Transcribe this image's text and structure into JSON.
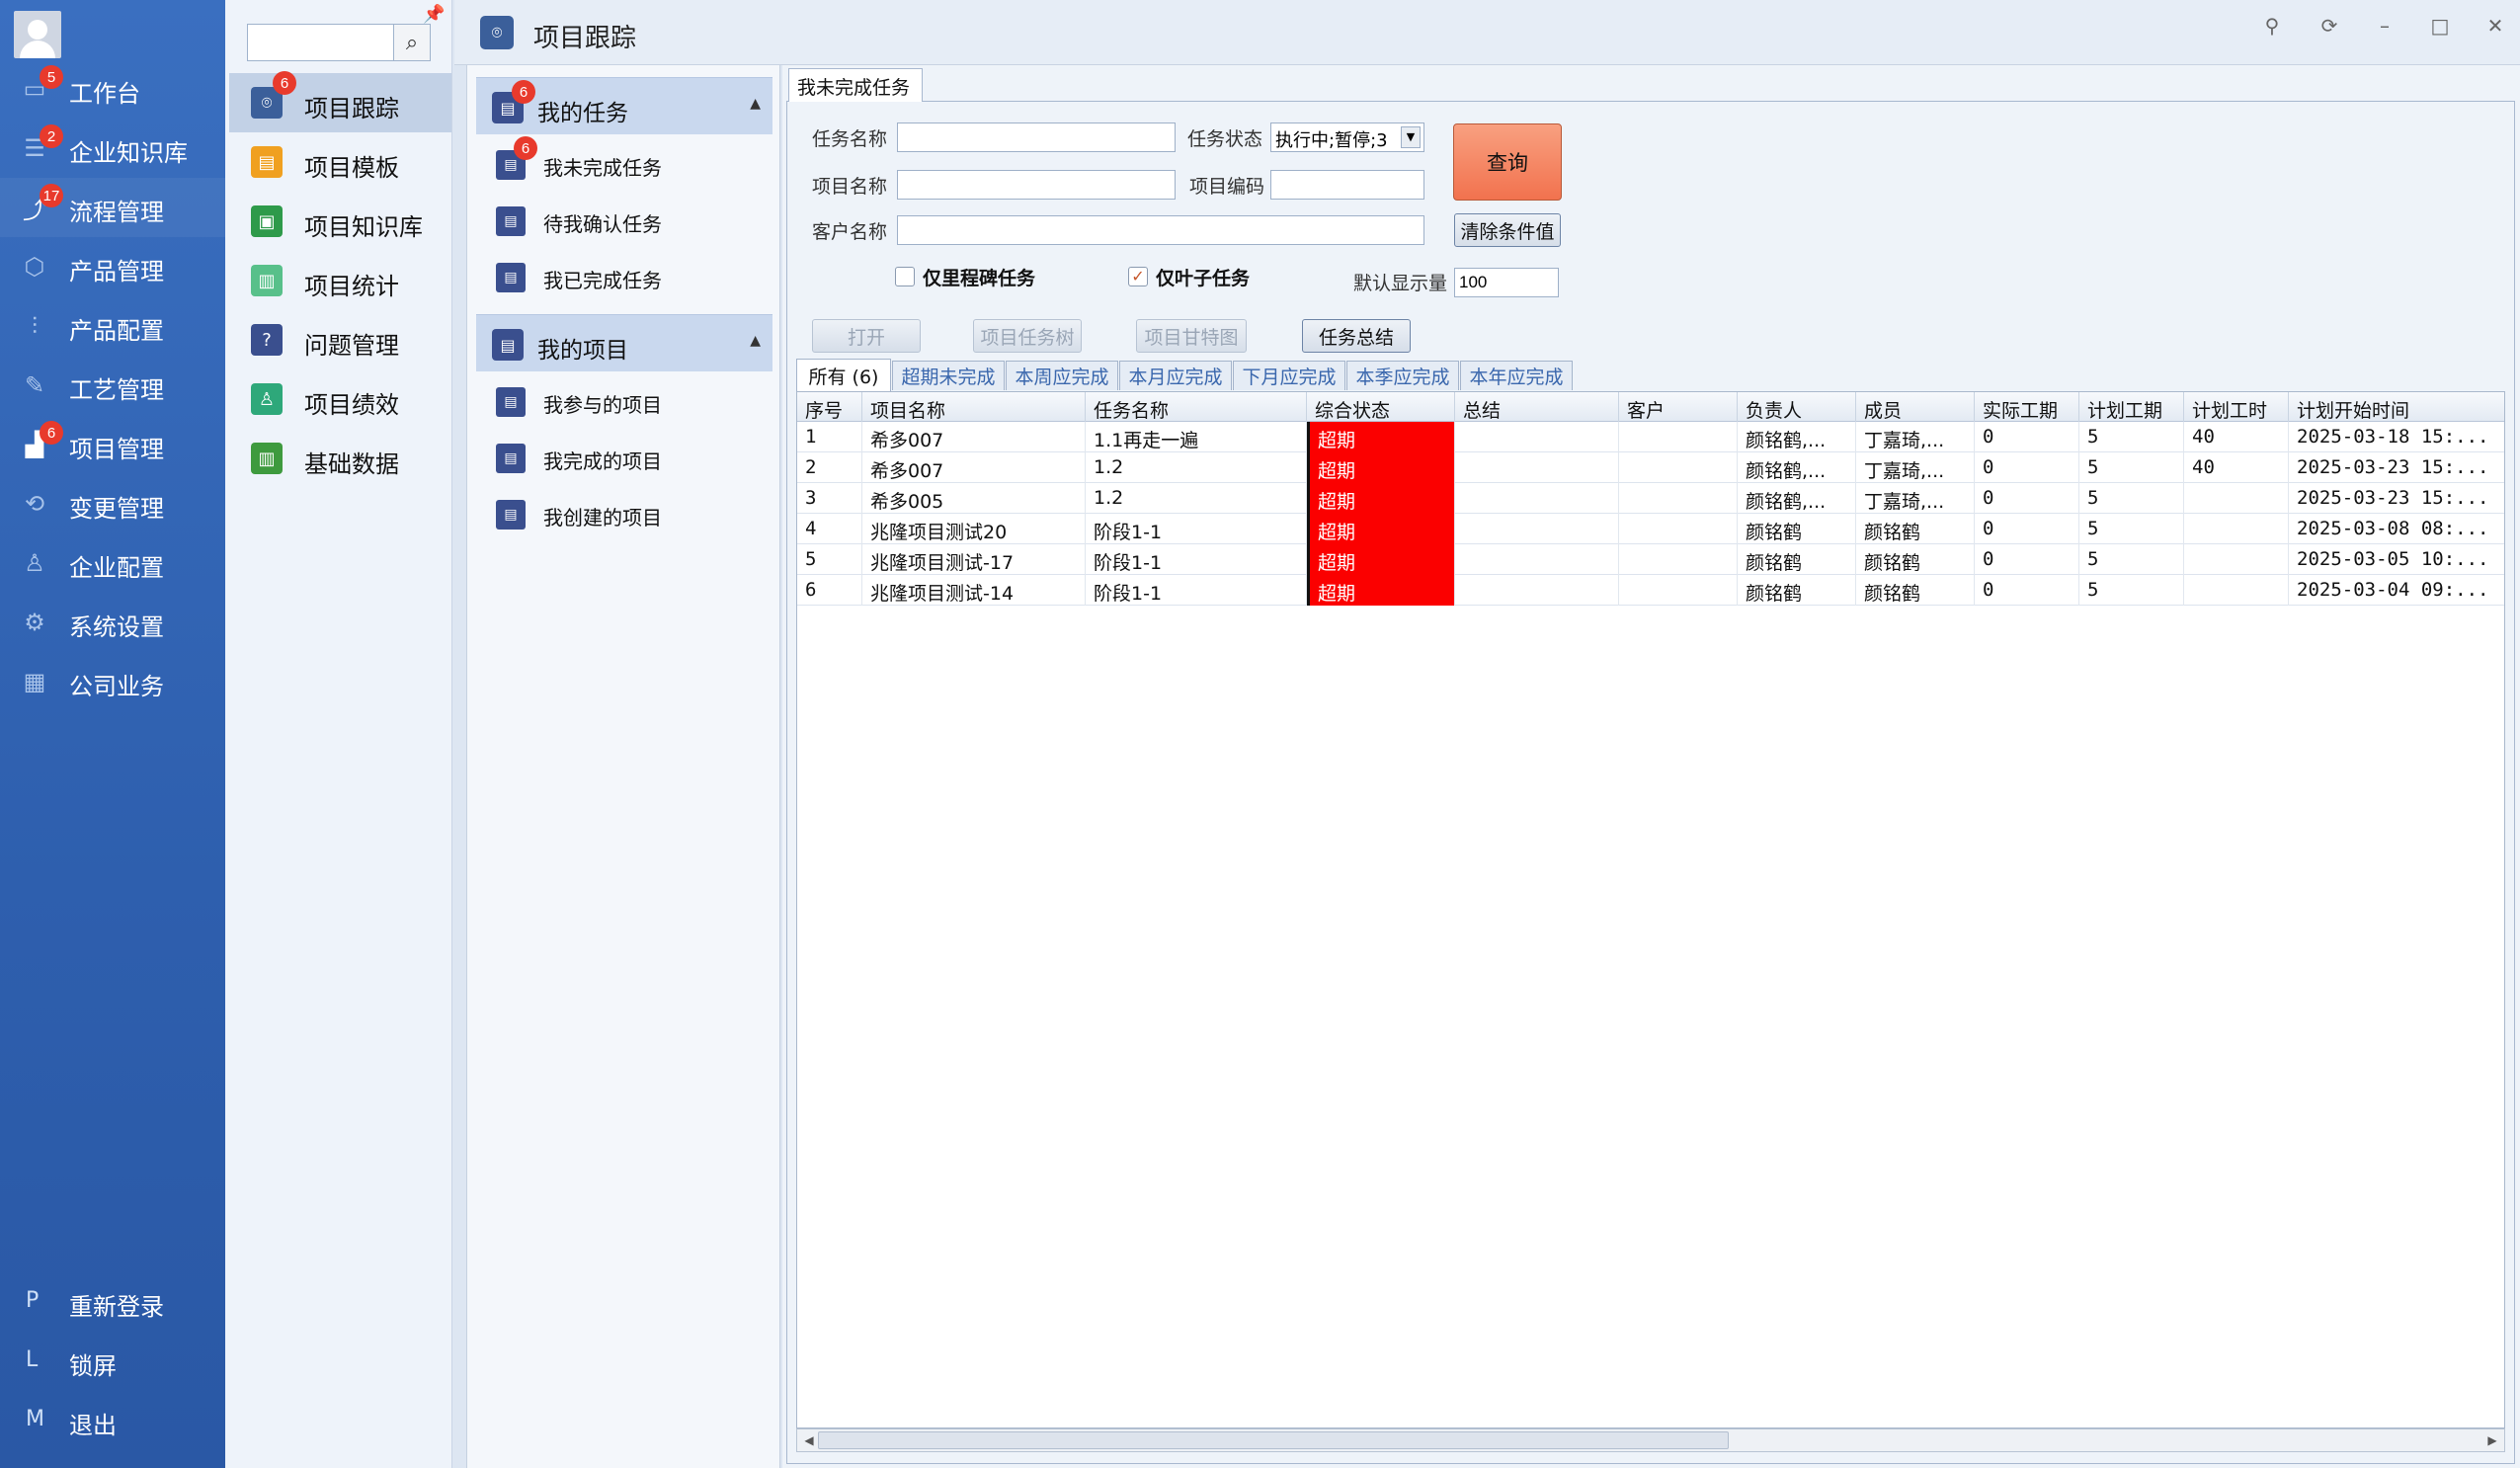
{
  "leftnav": {
    "items": [
      {
        "label": "工作台",
        "icon": "monitor-icon",
        "badge": "5"
      },
      {
        "label": "企业知识库",
        "icon": "doc-list-icon",
        "badge": "2"
      },
      {
        "label": "流程管理",
        "icon": "workflow-icon",
        "badge": "17"
      },
      {
        "label": "产品管理",
        "icon": "box-icon",
        "badge": ""
      },
      {
        "label": "产品配置",
        "icon": "sliders-icon",
        "badge": ""
      },
      {
        "label": "工艺管理",
        "icon": "wrench-icon",
        "badge": ""
      },
      {
        "label": "项目管理",
        "icon": "project-chart-icon",
        "badge": "6"
      },
      {
        "label": "变更管理",
        "icon": "change-icon",
        "badge": ""
      },
      {
        "label": "企业配置",
        "icon": "users-icon",
        "badge": ""
      },
      {
        "label": "系统设置",
        "icon": "gear-icon",
        "badge": ""
      },
      {
        "label": "公司业务",
        "icon": "grid-icon",
        "badge": ""
      }
    ],
    "system": [
      {
        "key": "P",
        "label": "重新登录"
      },
      {
        "key": "L",
        "label": "锁屏"
      },
      {
        "key": "M",
        "label": "退出"
      }
    ]
  },
  "subnav": {
    "search_value": "",
    "items": [
      {
        "label": "项目跟踪",
        "icon": "location-icon",
        "color": "#3b5f9a",
        "badge": "6"
      },
      {
        "label": "项目模板",
        "icon": "template-icon",
        "color": "#f0a020",
        "badge": ""
      },
      {
        "label": "项目知识库",
        "icon": "book-icon",
        "color": "#2e9a4a",
        "badge": ""
      },
      {
        "label": "项目统计",
        "icon": "stats-icon",
        "color": "#58c08a",
        "badge": ""
      },
      {
        "label": "问题管理",
        "icon": "question-icon",
        "color": "#3a4f8e",
        "badge": ""
      },
      {
        "label": "项目绩效",
        "icon": "performance-icon",
        "color": "#2ea87a",
        "badge": ""
      },
      {
        "label": "基础数据",
        "icon": "data-book-icon",
        "color": "#3e9a3e",
        "badge": ""
      }
    ]
  },
  "header": {
    "title": "项目跟踪"
  },
  "tasks_panel": {
    "group1": {
      "label": "我的任务",
      "badge": "6"
    },
    "group1_items": [
      {
        "label": "我未完成任务",
        "badge": "6"
      },
      {
        "label": "待我确认任务",
        "badge": ""
      },
      {
        "label": "我已完成任务",
        "badge": ""
      }
    ],
    "group2": {
      "label": "我的项目"
    },
    "group2_items": [
      {
        "label": "我参与的项目"
      },
      {
        "label": "我完成的项目"
      },
      {
        "label": "我创建的项目"
      }
    ]
  },
  "doc_tab": "我未完成任务",
  "form": {
    "task_name_label": "任务名称",
    "task_name_value": "",
    "task_status_label": "任务状态",
    "task_status_value": "执行中;暂停;3",
    "project_name_label": "项目名称",
    "project_name_value": "",
    "project_code_label": "项目编码",
    "project_code_value": "",
    "customer_label": "客户名称",
    "customer_value": "",
    "query_label": "查询",
    "clear_label": "清除条件值",
    "milestone_label": "仅里程碑任务",
    "milestone_checked": false,
    "leaf_label": "仅叶子任务",
    "leaf_checked": true,
    "default_count_label": "默认显示量",
    "default_count_value": "100"
  },
  "actions": {
    "open": "打开",
    "task_tree": "项目任务树",
    "gantt": "项目甘特图",
    "summary": "任务总结"
  },
  "filter_tabs": [
    "所有 (6)",
    "超期未完成",
    "本周应完成",
    "本月应完成",
    "下月应完成",
    "本季应完成",
    "本年应完成"
  ],
  "table": {
    "columns": [
      "序号",
      "项目名称",
      "任务名称",
      "综合状态",
      "总结",
      "客户",
      "负责人",
      "成员",
      "实际工期",
      "计划工期",
      "计划工时",
      "计划开始时间"
    ],
    "rows": [
      [
        "1",
        "希多007",
        "1.1再走一遍",
        "超期",
        "",
        "",
        "颜铭鹤,...",
        "丁嘉琦,...",
        "0",
        "5",
        "40",
        "2025-03-18 15:..."
      ],
      [
        "2",
        "希多007",
        "1.2",
        "超期",
        "",
        "",
        "颜铭鹤,...",
        "丁嘉琦,...",
        "0",
        "5",
        "40",
        "2025-03-23 15:..."
      ],
      [
        "3",
        "希多005",
        "1.2",
        "超期",
        "",
        "",
        "颜铭鹤,...",
        "丁嘉琦,...",
        "0",
        "5",
        "",
        "2025-03-23 15:..."
      ],
      [
        "4",
        "兆隆项目测试20",
        "阶段1-1",
        "超期",
        "",
        "",
        "颜铭鹤",
        "颜铭鹤",
        "0",
        "5",
        "",
        "2025-03-08 08:..."
      ],
      [
        "5",
        "兆隆项目测试-17",
        "阶段1-1",
        "超期",
        "",
        "",
        "颜铭鹤",
        "颜铭鹤",
        "0",
        "5",
        "",
        "2025-03-05 10:..."
      ],
      [
        "6",
        "兆隆项目测试-14",
        "阶段1-1",
        "超期",
        "",
        "",
        "颜铭鹤",
        "颜铭鹤",
        "0",
        "5",
        "",
        "2025-03-04 09:..."
      ]
    ]
  },
  "colors": {
    "overdue": "#fb0000",
    "accent": "#2e5fae",
    "query": "#f2724e"
  }
}
